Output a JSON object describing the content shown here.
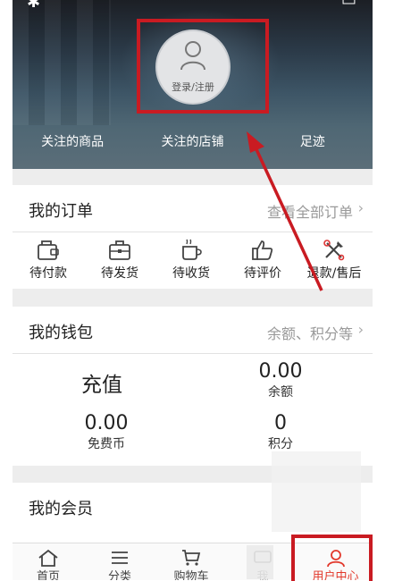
{
  "header": {
    "login_label": "登录/注册",
    "links": [
      "关注的商品",
      "关注的店铺",
      "足迹"
    ]
  },
  "orders": {
    "title": "我的订单",
    "more": "查看全部订单",
    "items": [
      "待付款",
      "待发货",
      "待收货",
      "待评价",
      "退款/售后"
    ]
  },
  "wallet": {
    "title": "我的钱包",
    "more": "余额、积分等",
    "recharge": "充值",
    "balance": {
      "value": "0.00",
      "label": "余额"
    },
    "coins": {
      "value": "0.00",
      "label": "免费币"
    },
    "points": {
      "value": "0",
      "label": "积分"
    }
  },
  "member": {
    "title": "我的会员"
  },
  "bottom_nav": [
    "首页",
    "分类",
    "购物车",
    "我",
    "用户中心"
  ],
  "colors": {
    "highlight": "#c91b22",
    "active": "#e2382b"
  }
}
